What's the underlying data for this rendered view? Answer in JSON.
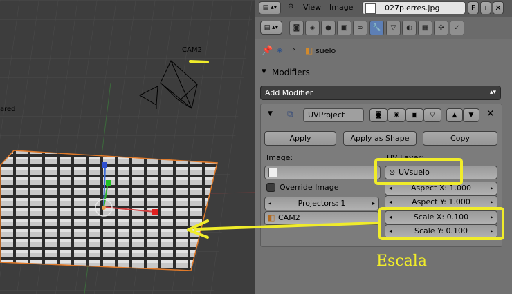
{
  "viewport": {
    "camera_label": "CAM2",
    "cut_text": "ared"
  },
  "header": {
    "menu_view": "View",
    "menu_image": "Image",
    "image_name": "027pierres.jpg",
    "fake_user": "F"
  },
  "context": {
    "object_name": "suelo"
  },
  "modifiers": {
    "section_title": "Modifiers",
    "add_modifier": "Add Modifier",
    "modifier_name": "UVProject",
    "apply": "Apply",
    "apply_as_shape": "Apply as Shape",
    "copy": "Copy",
    "image_label": "Image:",
    "uv_layer_label": "UV Layer:",
    "uv_layer_value": "UVsuelo",
    "override_image": "Override Image",
    "projectors": "Projectors: 1",
    "camera_object": "CAM2",
    "aspect_x": "Aspect X: 1.000",
    "aspect_y": "Aspect Y: 1.000",
    "scale_x": "Scale X: 0.100",
    "scale_y": "Scale Y: 0.100"
  },
  "annotation": {
    "escala": "Escala",
    "highlight_color": "#f0ec2a"
  }
}
